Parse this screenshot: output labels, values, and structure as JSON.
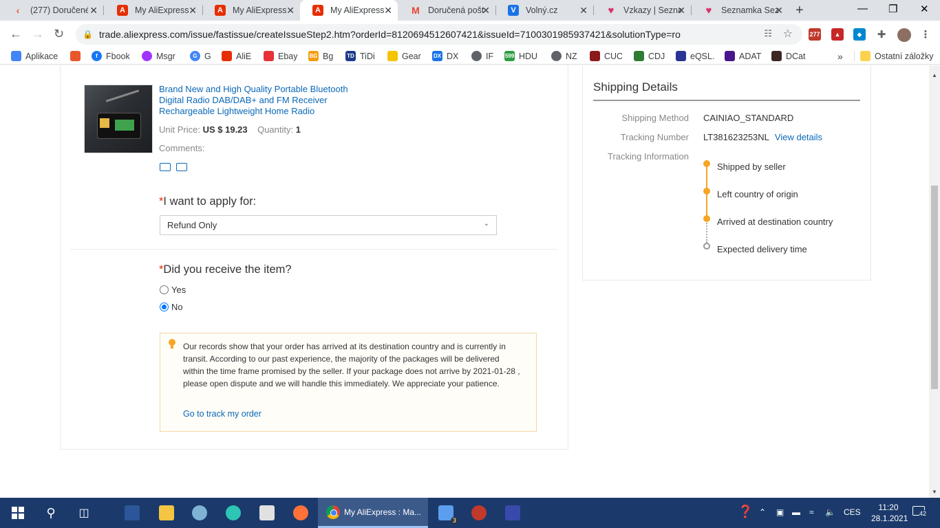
{
  "browser": {
    "tabs": [
      {
        "label": "(277) Doručené",
        "icon": "aliexpress-icon",
        "color": "#e8562a"
      },
      {
        "label": "My AliExpress",
        "icon": "aliexpress-icon",
        "color": "#e62e04"
      },
      {
        "label": "My AliExpress",
        "icon": "aliexpress-icon",
        "color": "#e62e04"
      },
      {
        "label": "My AliExpress",
        "icon": "aliexpress-icon",
        "color": "#e62e04",
        "active": true
      },
      {
        "label": "Doručená pošt",
        "icon": "gmail-icon",
        "color": "#ea4335"
      },
      {
        "label": "Volný.cz",
        "icon": "volny-icon",
        "color": "#1a73e8"
      },
      {
        "label": "Vzkazy | Sezna",
        "icon": "heart-icon",
        "color": "#d6336c"
      },
      {
        "label": "Seznamka Sezn",
        "icon": "heart-icon",
        "color": "#d6336c"
      }
    ],
    "url": "trade.aliexpress.com/issue/fastissue/createIssueStep2.htm?orderId=8120694512607421&issueId=7100301985937421&solutionType=ro",
    "extension_badge": "277",
    "bookmarks": [
      {
        "label": "Aplikace",
        "color": "#4285f4"
      },
      {
        "label": "",
        "color": "#e8562a"
      },
      {
        "label": "Fbook",
        "color": "#1877f2"
      },
      {
        "label": "Msgr",
        "color": "#a033ff"
      },
      {
        "label": "G",
        "color": "#4285f4"
      },
      {
        "label": "AliE",
        "color": "#e62e04"
      },
      {
        "label": "Ebay",
        "color": "#e53238"
      },
      {
        "label": "Bg",
        "color": "#f39c12"
      },
      {
        "label": "TiDi",
        "color": "#1e3a8a"
      },
      {
        "label": "Gear",
        "color": "#f5c400"
      },
      {
        "label": "DX",
        "color": "#1a73e8"
      },
      {
        "label": "IF",
        "color": "#5f6368"
      },
      {
        "label": "HDU",
        "color": "#2e9e44"
      },
      {
        "label": "NZ",
        "color": "#5f6368"
      },
      {
        "label": "CUC",
        "color": "#8b1a1a"
      },
      {
        "label": "CDJ",
        "color": "#2e7d32"
      },
      {
        "label": "eQSL.",
        "color": "#283593"
      },
      {
        "label": "ADAT",
        "color": "#4a148c"
      },
      {
        "label": "DCat",
        "color": "#3e2723"
      }
    ],
    "other_bookmarks": "Ostatní záložky",
    "more_bookmarks": "»"
  },
  "product": {
    "title": "Brand New and High Quality Portable Bluetooth Digital Radio DAB/DAB+ and FM Receiver Rechargeable Lightweight Home Radio",
    "unit_price_label": "Unit Price:",
    "unit_price": "US $ 19.23",
    "quantity_label": "Quantity:",
    "quantity": "1",
    "comments_label": "Comments:"
  },
  "form": {
    "required_mark": "*",
    "apply_label": "I want to apply for:",
    "apply_selected": "Refund Only",
    "received_label": "Did you receive the item?",
    "option_yes": "Yes",
    "option_no": "No",
    "selected_option": "No",
    "notice_text": "Our records show that your order has arrived at its destination country and is currently in transit. According to our past experience, the majority of the packages will be delivered within the time frame promised by the seller. If your package does not arrive by 2021-01-28 , please open dispute and we will handle this immediately. We appreciate your patience.",
    "notice_link": "Go to track my order"
  },
  "shipping": {
    "title": "Shipping Details",
    "method_label": "Shipping Method",
    "method": "CAINIAO_STANDARD",
    "tracking_label": "Tracking Number",
    "tracking_number": "LT381623253NL",
    "view_details": "View details",
    "info_label": "Tracking Information",
    "events": [
      {
        "text": "Shipped by seller",
        "done": true
      },
      {
        "text": "Left country of origin",
        "done": true
      },
      {
        "text": "Arrived at destination country",
        "done": true
      },
      {
        "text": "Expected delivery time",
        "done": false
      }
    ]
  },
  "taskbar": {
    "active_app": "My AliExpress : Ma...",
    "mail_badge": "3",
    "language": "CES",
    "time": "11:20",
    "date": "28.1.2021",
    "notifications": "42"
  },
  "colors": {
    "accent_orange": "#f5a623",
    "link_blue": "#0a68b8",
    "required_red": "#e62e04"
  }
}
